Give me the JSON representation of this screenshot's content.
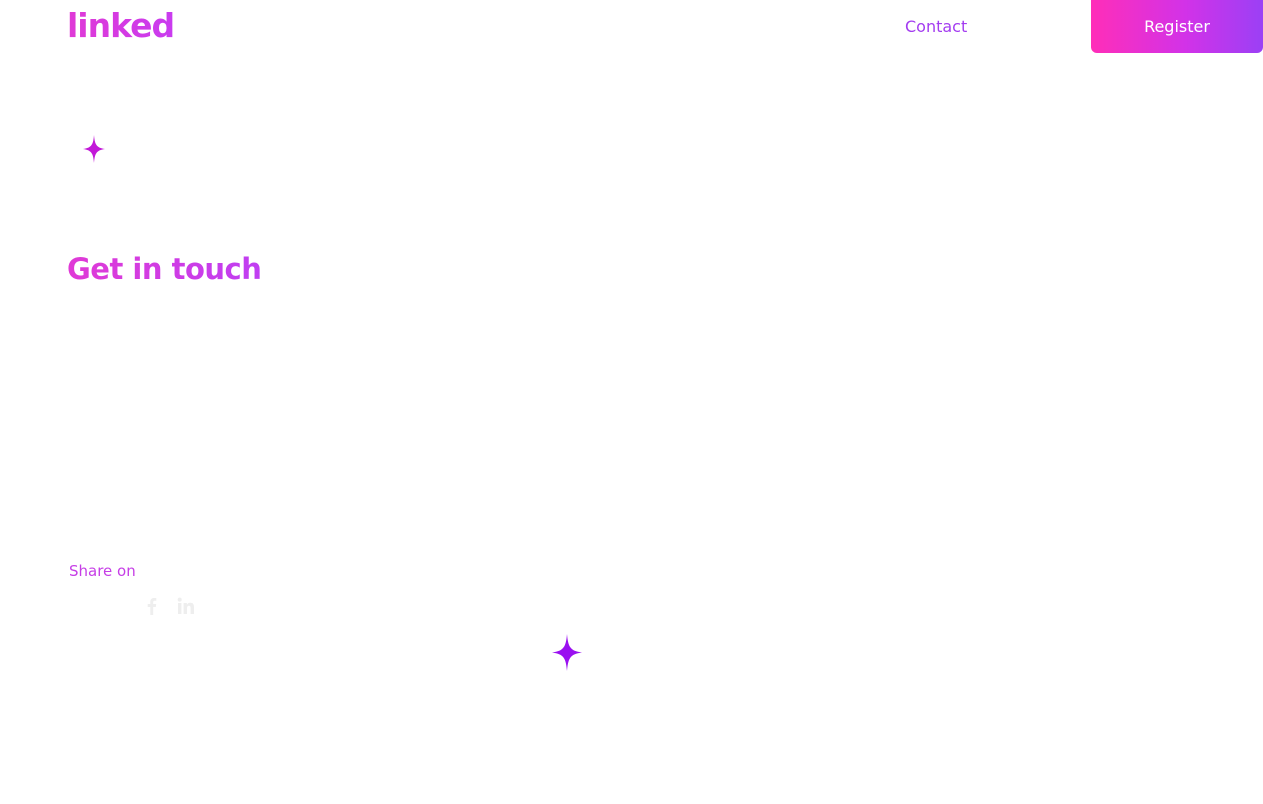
{
  "header": {
    "logo_text": "linked",
    "nav": {
      "contact_label": "Contact"
    },
    "register_label": "Register"
  },
  "main": {
    "heading": "Get in touch"
  },
  "share": {
    "label": "Share on",
    "icons": [
      "facebook-icon",
      "linkedin-icon"
    ]
  },
  "colors": {
    "brand_pink": "#e03ad6",
    "brand_purple": "#a33cf0",
    "sparkle_small": "#c218d8",
    "sparkle_large": "#9a10f0",
    "social_icon": "#eeeeee"
  }
}
